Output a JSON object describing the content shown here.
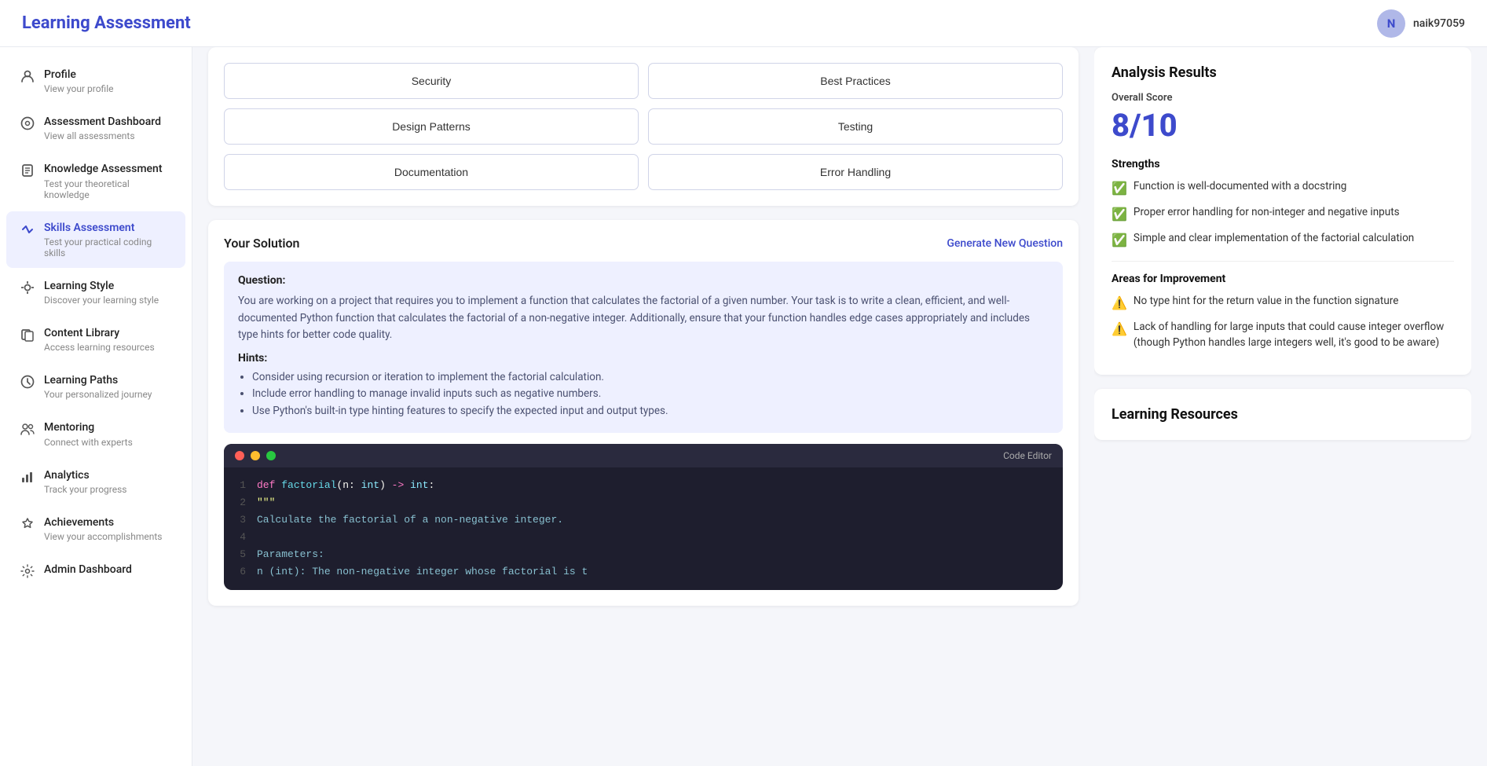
{
  "header": {
    "title": "Learning Assessment",
    "user": {
      "initial": "N",
      "username": "naik97059"
    }
  },
  "sidebar": {
    "items": [
      {
        "id": "profile",
        "icon": "👤",
        "title": "Profile",
        "sub": "View your profile",
        "active": false
      },
      {
        "id": "assessment-dashboard",
        "icon": "⊙",
        "title": "Assessment Dashboard",
        "sub": "View all assessments",
        "active": false
      },
      {
        "id": "knowledge-assessment",
        "icon": "📖",
        "title": "Knowledge Assessment",
        "sub": "Test your theoretical knowledge",
        "active": false
      },
      {
        "id": "skills-assessment",
        "icon": "<>",
        "title": "Skills Assessment",
        "sub": "Test your practical coding skills",
        "active": true
      },
      {
        "id": "learning-style",
        "icon": "💡",
        "title": "Learning Style",
        "sub": "Discover your learning style",
        "active": false
      },
      {
        "id": "content-library",
        "icon": "📚",
        "title": "Content Library",
        "sub": "Access learning resources",
        "active": false
      },
      {
        "id": "learning-paths",
        "icon": "⊕",
        "title": "Learning Paths",
        "sub": "Your personalized journey",
        "active": false
      },
      {
        "id": "mentoring",
        "icon": "👥",
        "title": "Mentoring",
        "sub": "Connect with experts",
        "active": false
      },
      {
        "id": "analytics",
        "icon": "📊",
        "title": "Analytics",
        "sub": "Track your progress",
        "active": false
      },
      {
        "id": "achievements",
        "icon": "🏆",
        "title": "Achievements",
        "sub": "View your accomplishments",
        "active": false
      },
      {
        "id": "admin-dashboard",
        "icon": "⚙",
        "title": "Admin Dashboard",
        "sub": "",
        "active": false
      }
    ]
  },
  "topics": {
    "grid": [
      {
        "label": "Security"
      },
      {
        "label": "Best Practices"
      },
      {
        "label": "Design Patterns"
      },
      {
        "label": "Testing"
      },
      {
        "label": "Documentation"
      },
      {
        "label": "Error Handling"
      }
    ]
  },
  "solution": {
    "title": "Your Solution",
    "generate_link": "Generate New Question",
    "question_label": "Question:",
    "question_text": "You are working on a project that requires you to implement a function that calculates the factorial of a given number. Your task is to write a clean, efficient, and well-documented Python function that calculates the factorial of a non-negative integer. Additionally, ensure that your function handles edge cases appropriately and includes type hints for better code quality.",
    "hints_label": "Hints:",
    "hints": [
      "Consider using recursion or iteration to implement the factorial calculation.",
      "Include error handling to manage invalid inputs such as negative numbers.",
      "Use Python's built-in type hinting features to specify the expected input and output types."
    ]
  },
  "code_editor": {
    "label": "Code Editor",
    "lines": [
      {
        "num": 1,
        "code": "def factorial(n: int) -> int:"
      },
      {
        "num": 2,
        "code": "    \"\"\""
      },
      {
        "num": 3,
        "code": "        Calculate the factorial of a non-negative integer."
      },
      {
        "num": 4,
        "code": ""
      },
      {
        "num": 5,
        "code": "        Parameters:"
      },
      {
        "num": 6,
        "code": "        n (int): The non-negative integer whose factorial is t"
      }
    ]
  },
  "analysis": {
    "title": "Analysis Results",
    "score_label": "Overall Score",
    "score": "8/10",
    "strengths_label": "Strengths",
    "strengths": [
      "Function is well-documented with a docstring",
      "Proper error handling for non-integer and negative inputs",
      "Simple and clear implementation of the factorial calculation"
    ],
    "improvements_label": "Areas for Improvement",
    "improvements": [
      "No type hint for the return value in the function signature",
      "Lack of handling for large inputs that could cause integer overflow (though Python handles large integers well, it's good to be aware)"
    ]
  },
  "resources": {
    "title": "Learning Resources"
  }
}
